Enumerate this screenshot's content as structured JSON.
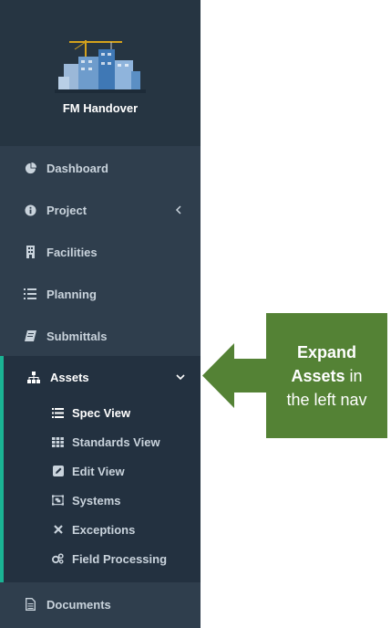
{
  "brand": {
    "title": "FM Handover"
  },
  "nav": {
    "dashboard": "Dashboard",
    "project": "Project",
    "facilities": "Facilities",
    "planning": "Planning",
    "submittals": "Submittals",
    "assets": "Assets",
    "documents": "Documents"
  },
  "assets_sub": {
    "spec_view": "Spec View",
    "standards_view": "Standards View",
    "edit_view": "Edit View",
    "systems": "Systems",
    "exceptions": "Exceptions",
    "field_processing": "Field Processing"
  },
  "callout": {
    "line1": "Expand",
    "line2_bold": "Assets",
    "line2_rest": " in",
    "line3": "the left nav"
  },
  "colors": {
    "sidebar_bg": "#2f3e4d",
    "brand_bg": "#263542",
    "active_block_bg": "#233140",
    "active_accent": "#1ab394",
    "callout_green": "#548235"
  },
  "icons": {
    "dashboard": "pie-chart-icon",
    "project": "info-circle-icon",
    "facilities": "building-icon",
    "planning": "list-icon",
    "submittals": "book-icon",
    "assets": "sitemap-icon",
    "spec_view": "list-lines-icon",
    "standards_view": "grid-icon",
    "edit_view": "edit-icon",
    "systems": "object-group-icon",
    "exceptions": "close-icon",
    "field_processing": "gears-icon",
    "documents": "file-icon"
  }
}
